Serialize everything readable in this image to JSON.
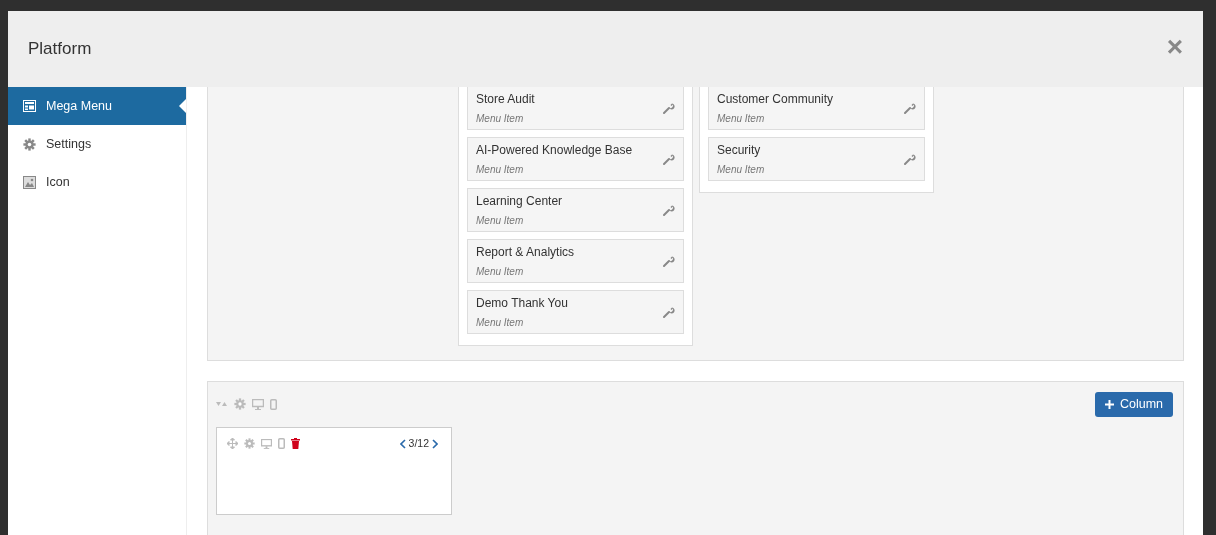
{
  "modal": {
    "title": "Platform",
    "close": "×"
  },
  "sidebar": {
    "items": [
      {
        "label": "Mega Menu",
        "selected": true
      },
      {
        "label": "Settings",
        "selected": false
      },
      {
        "label": "Icon",
        "selected": false
      }
    ]
  },
  "rows": [
    {
      "kind": "menu_columns",
      "columns": [
        {
          "items": [
            {
              "title": "Store Audit",
              "subtitle": "Menu Item"
            },
            {
              "title": "AI-Powered Knowledge Base",
              "subtitle": "Menu Item"
            },
            {
              "title": "Learning Center",
              "subtitle": "Menu Item"
            },
            {
              "title": "Report & Analytics",
              "subtitle": "Menu Item"
            },
            {
              "title": "Demo Thank You",
              "subtitle": "Menu Item"
            }
          ]
        },
        {
          "items": [
            {
              "title": "Customer Community",
              "subtitle": "Menu Item"
            },
            {
              "title": "Security",
              "subtitle": "Menu Item"
            }
          ]
        }
      ]
    },
    {
      "kind": "empty_column",
      "add_button": "Column",
      "column_width": "3/12"
    }
  ]
}
